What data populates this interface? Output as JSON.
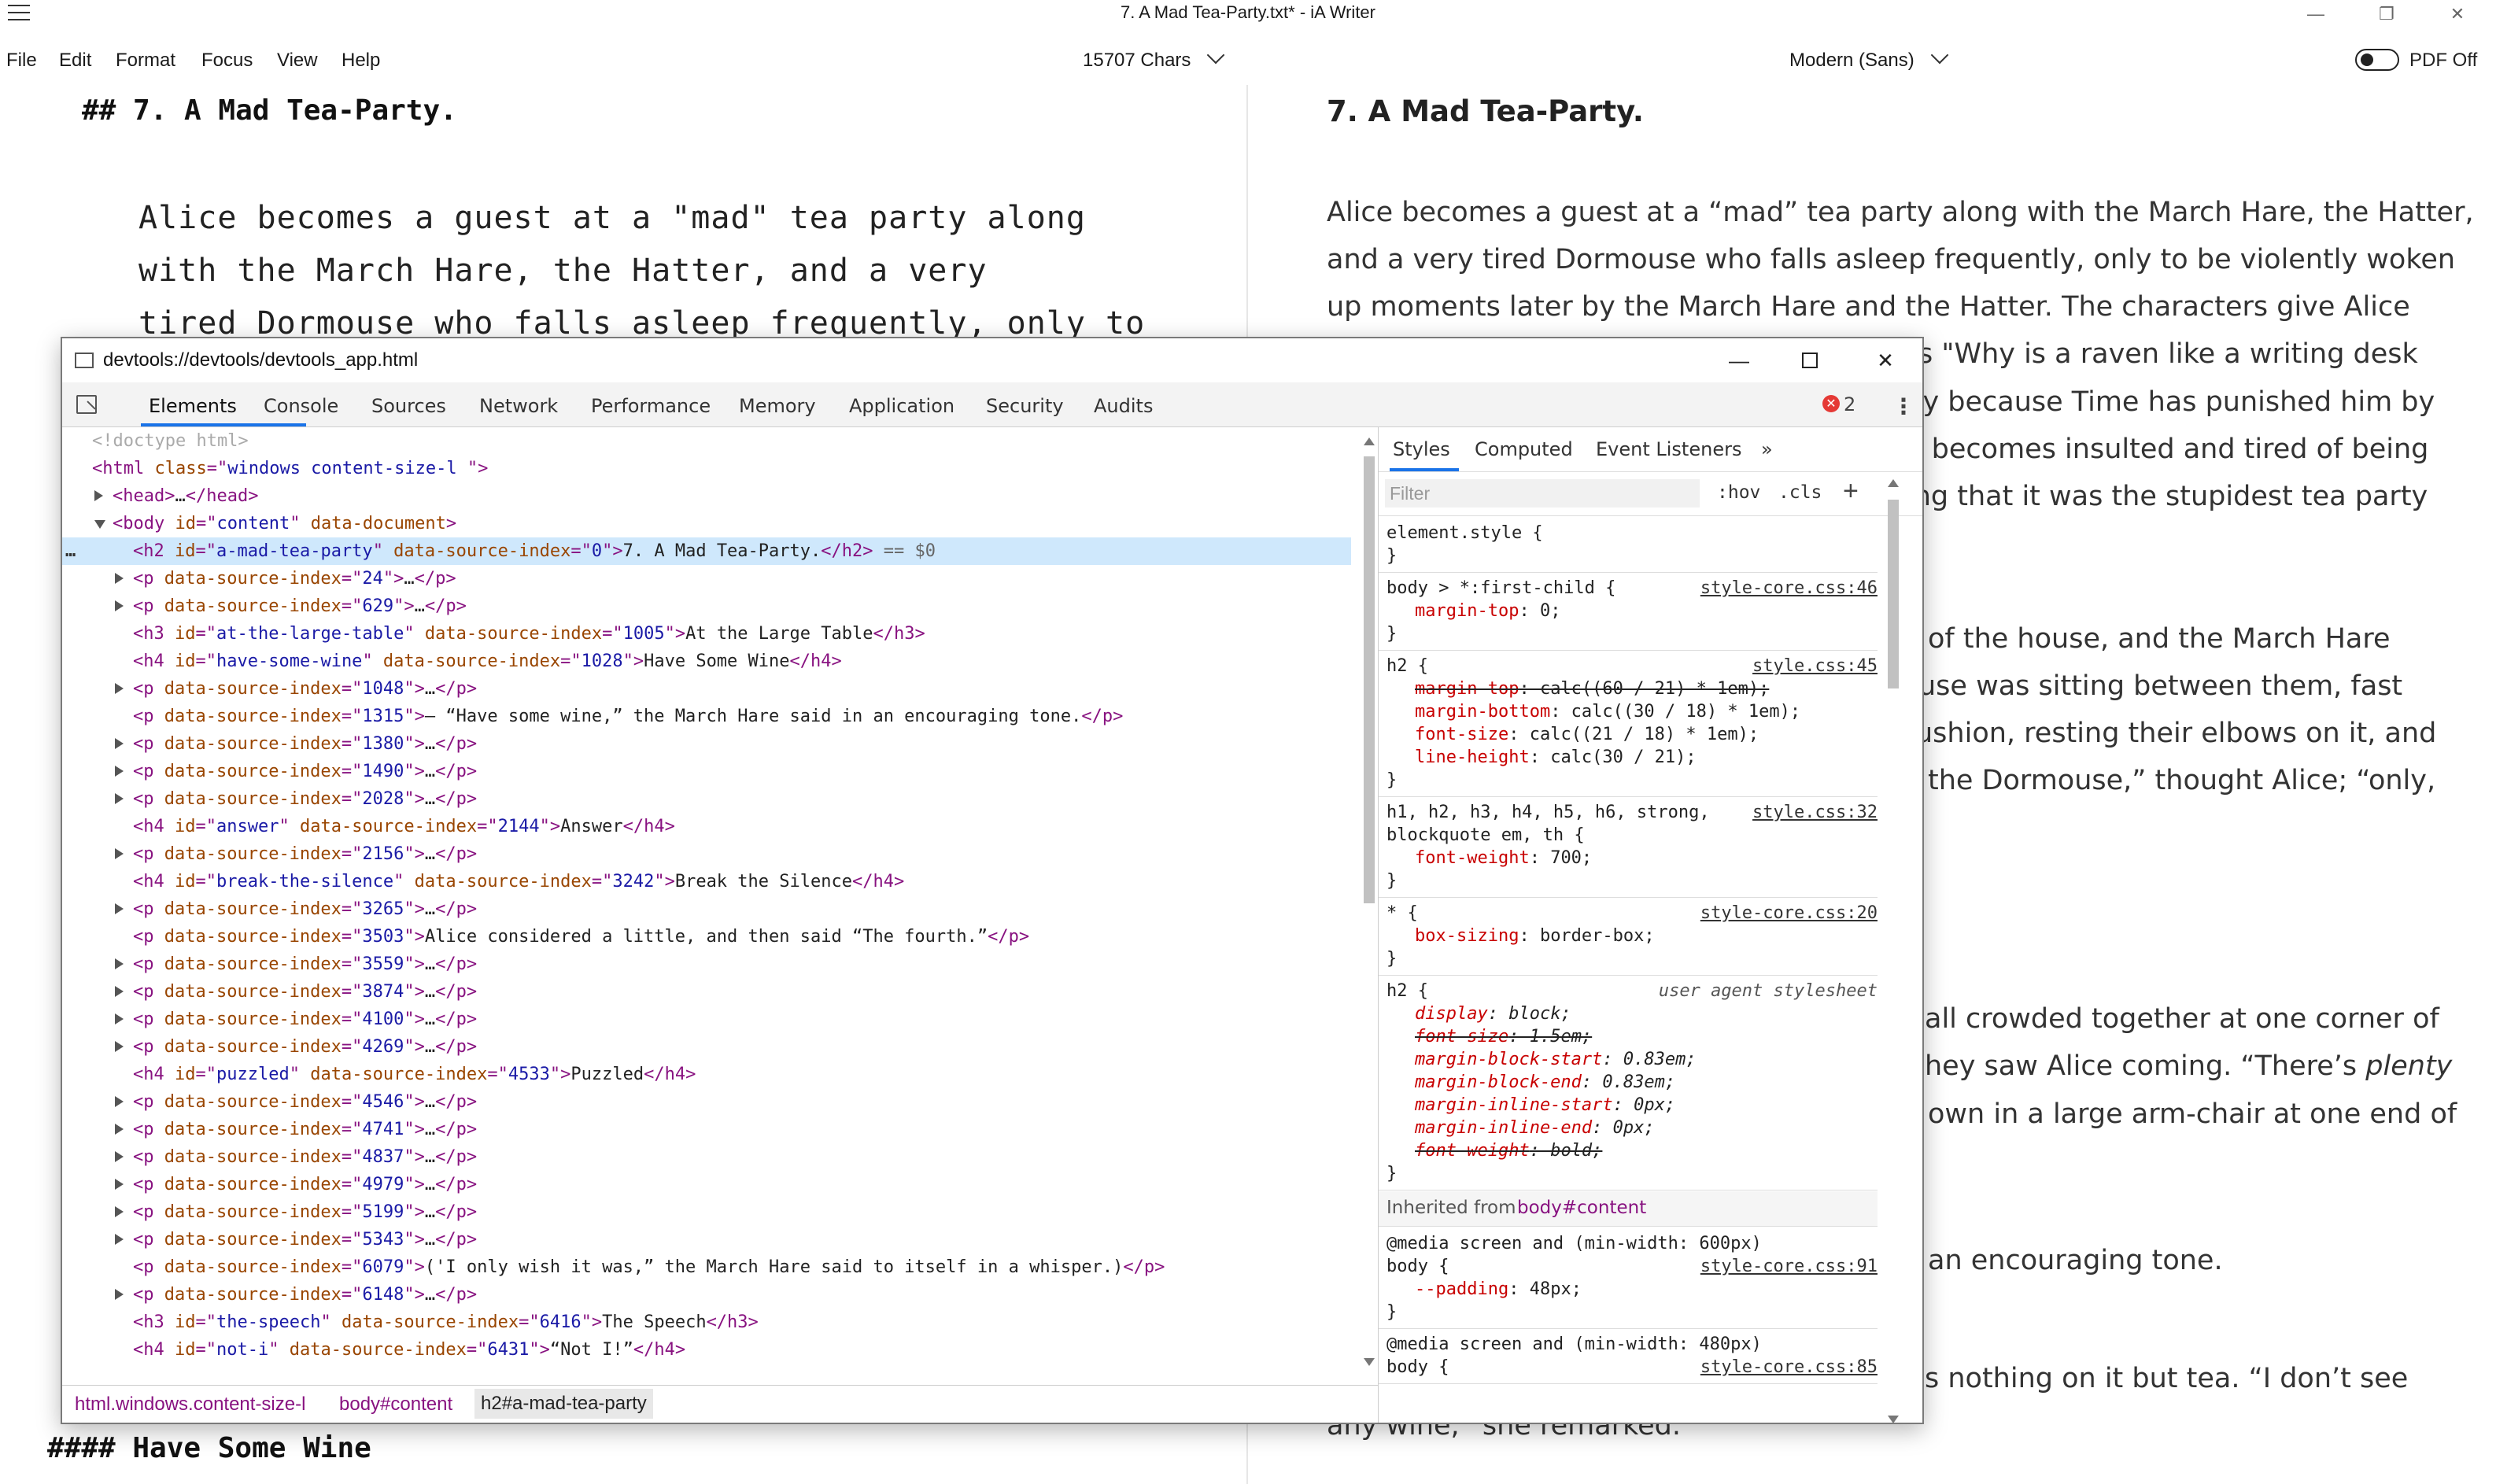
{
  "window": {
    "title": "7. A Mad Tea-Party.txt*  - iA Writer",
    "controls": [
      "—",
      "❐",
      "✕"
    ]
  },
  "menu": [
    "File",
    "Edit",
    "Format",
    "Focus",
    "View",
    "Help"
  ],
  "stats": {
    "chars": "15707 Chars",
    "font": "Modern (Sans)",
    "pdf": "PDF Off"
  },
  "editor": {
    "heading": "## 7. A Mad Tea-Party.",
    "paragraph_lines": [
      "Alice becomes a guest at a \"mad\" tea party along",
      "with the March Hare, the Hatter, and a very",
      "tired Dormouse who falls asleep frequently, only to"
    ],
    "bottom_heading": "#### Have Some Wine"
  },
  "preview": {
    "heading": "7. A Mad Tea-Party.",
    "lines_full": [
      "Alice becomes a guest at a “mad” tea party along with the March Hare, the Hatter,",
      "and a very tired Dormouse who falls asleep frequently, only to be violently woken",
      "up moments later by the March Hare and the Hatter. The characters give Alice"
    ],
    "lines_partial": [
      "s \"Why is a raven like a writing desk",
      "ay because Time has punished him by",
      "e becomes insulted and tired of being",
      "ing that it was the stupidest tea party",
      "of the house, and the March Hare",
      "use was sitting between them, fast",
      "ushion, resting their elbows on it, and",
      "the Dormouse,” thought Alice; “only,",
      "all crowded together at one corner of",
      "hey saw Alice coming. “There’s ",
      "own in a large arm-chair at one end of",
      "an encouraging tone.",
      "s nothing on it but tea. “I don’t see"
    ],
    "italic_word": "plenty",
    "bottom_line": "any wine,” she remarked."
  },
  "devtools": {
    "title": "devtools://devtools/devtools_app.html",
    "tabs": [
      "Elements",
      "Console",
      "Sources",
      "Network",
      "Performance",
      "Memory",
      "Application",
      "Security",
      "Audits"
    ],
    "error_count": "2",
    "error_icon": "✕",
    "more_icon": "⋮",
    "dom": [
      {
        "indent": 0,
        "kind": "comment",
        "text": "<!doctype html>"
      },
      {
        "indent": 0,
        "kind": "open",
        "tag": "html",
        "attrs": [
          [
            "class",
            "windows content-size-l "
          ]
        ],
        "suffix": ">"
      },
      {
        "indent": 1,
        "kind": "collapsed",
        "tag": "head",
        "attrs": [],
        "arrow": "r"
      },
      {
        "indent": 1,
        "kind": "open",
        "tag": "body",
        "attrs": [
          [
            "id",
            "content"
          ],
          [
            "data-document",
            null
          ]
        ],
        "arrow": "d"
      },
      {
        "indent": 2,
        "kind": "full",
        "tag": "h2",
        "attrs": [
          [
            "id",
            "a-mad-tea-party"
          ],
          [
            "data-source-index",
            "0"
          ]
        ],
        "text": "7. A Mad Tea-Party.",
        "selected": true,
        "eq": " == $0"
      },
      {
        "indent": 2,
        "kind": "collapsed",
        "tag": "p",
        "attrs": [
          [
            "data-source-index",
            "24"
          ]
        ],
        "arrow": "r"
      },
      {
        "indent": 2,
        "kind": "collapsed",
        "tag": "p",
        "attrs": [
          [
            "data-source-index",
            "629"
          ]
        ],
        "arrow": "r"
      },
      {
        "indent": 2,
        "kind": "full",
        "tag": "h3",
        "attrs": [
          [
            "id",
            "at-the-large-table"
          ],
          [
            "data-source-index",
            "1005"
          ]
        ],
        "text": "At the Large Table"
      },
      {
        "indent": 2,
        "kind": "full",
        "tag": "h4",
        "attrs": [
          [
            "id",
            "have-some-wine"
          ],
          [
            "data-source-index",
            "1028"
          ]
        ],
        "text": "Have Some Wine"
      },
      {
        "indent": 2,
        "kind": "collapsed",
        "tag": "p",
        "attrs": [
          [
            "data-source-index",
            "1048"
          ]
        ],
        "arrow": "r"
      },
      {
        "indent": 2,
        "kind": "full",
        "tag": "p",
        "attrs": [
          [
            "data-source-index",
            "1315"
          ]
        ],
        "text": "— “Have some wine,” the March Hare said in an encouraging tone."
      },
      {
        "indent": 2,
        "kind": "collapsed",
        "tag": "p",
        "attrs": [
          [
            "data-source-index",
            "1380"
          ]
        ],
        "arrow": "r"
      },
      {
        "indent": 2,
        "kind": "collapsed",
        "tag": "p",
        "attrs": [
          [
            "data-source-index",
            "1490"
          ]
        ],
        "arrow": "r"
      },
      {
        "indent": 2,
        "kind": "collapsed",
        "tag": "p",
        "attrs": [
          [
            "data-source-index",
            "2028"
          ]
        ],
        "arrow": "r"
      },
      {
        "indent": 2,
        "kind": "full",
        "tag": "h4",
        "attrs": [
          [
            "id",
            "answer"
          ],
          [
            "data-source-index",
            "2144"
          ]
        ],
        "text": "Answer"
      },
      {
        "indent": 2,
        "kind": "collapsed",
        "tag": "p",
        "attrs": [
          [
            "data-source-index",
            "2156"
          ]
        ],
        "arrow": "r"
      },
      {
        "indent": 2,
        "kind": "full",
        "tag": "h4",
        "attrs": [
          [
            "id",
            "break-the-silence"
          ],
          [
            "data-source-index",
            "3242"
          ]
        ],
        "text": "Break the Silence"
      },
      {
        "indent": 2,
        "kind": "collapsed",
        "tag": "p",
        "attrs": [
          [
            "data-source-index",
            "3265"
          ]
        ],
        "arrow": "r"
      },
      {
        "indent": 2,
        "kind": "full",
        "tag": "p",
        "attrs": [
          [
            "data-source-index",
            "3503"
          ]
        ],
        "text": "Alice considered a little, and then said “The fourth.”"
      },
      {
        "indent": 2,
        "kind": "collapsed",
        "tag": "p",
        "attrs": [
          [
            "data-source-index",
            "3559"
          ]
        ],
        "arrow": "r"
      },
      {
        "indent": 2,
        "kind": "collapsed",
        "tag": "p",
        "attrs": [
          [
            "data-source-index",
            "3874"
          ]
        ],
        "arrow": "r"
      },
      {
        "indent": 2,
        "kind": "collapsed",
        "tag": "p",
        "attrs": [
          [
            "data-source-index",
            "4100"
          ]
        ],
        "arrow": "r"
      },
      {
        "indent": 2,
        "kind": "collapsed",
        "tag": "p",
        "attrs": [
          [
            "data-source-index",
            "4269"
          ]
        ],
        "arrow": "r"
      },
      {
        "indent": 2,
        "kind": "full",
        "tag": "h4",
        "attrs": [
          [
            "id",
            "puzzled"
          ],
          [
            "data-source-index",
            "4533"
          ]
        ],
        "text": "Puzzled"
      },
      {
        "indent": 2,
        "kind": "collapsed",
        "tag": "p",
        "attrs": [
          [
            "data-source-index",
            "4546"
          ]
        ],
        "arrow": "r"
      },
      {
        "indent": 2,
        "kind": "collapsed",
        "tag": "p",
        "attrs": [
          [
            "data-source-index",
            "4741"
          ]
        ],
        "arrow": "r"
      },
      {
        "indent": 2,
        "kind": "collapsed",
        "tag": "p",
        "attrs": [
          [
            "data-source-index",
            "4837"
          ]
        ],
        "arrow": "r"
      },
      {
        "indent": 2,
        "kind": "collapsed",
        "tag": "p",
        "attrs": [
          [
            "data-source-index",
            "4979"
          ]
        ],
        "arrow": "r"
      },
      {
        "indent": 2,
        "kind": "collapsed",
        "tag": "p",
        "attrs": [
          [
            "data-source-index",
            "5199"
          ]
        ],
        "arrow": "r"
      },
      {
        "indent": 2,
        "kind": "collapsed",
        "tag": "p",
        "attrs": [
          [
            "data-source-index",
            "5343"
          ]
        ],
        "arrow": "r"
      },
      {
        "indent": 2,
        "kind": "full",
        "tag": "p",
        "attrs": [
          [
            "data-source-index",
            "6079"
          ]
        ],
        "text": "('I only wish it was,” the March Hare said to itself in a whisper.)"
      },
      {
        "indent": 2,
        "kind": "collapsed",
        "tag": "p",
        "attrs": [
          [
            "data-source-index",
            "6148"
          ]
        ],
        "arrow": "r"
      },
      {
        "indent": 2,
        "kind": "full",
        "tag": "h3",
        "attrs": [
          [
            "id",
            "the-speech"
          ],
          [
            "data-source-index",
            "6416"
          ]
        ],
        "text": "The Speech"
      },
      {
        "indent": 2,
        "kind": "full",
        "tag": "h4",
        "attrs": [
          [
            "id",
            "not-i"
          ],
          [
            "data-source-index",
            "6431"
          ]
        ],
        "text": "“Not I!”"
      }
    ],
    "breadcrumb": [
      "html.windows.content-size-l",
      "body#content",
      "h2#a-mad-tea-party"
    ],
    "styles": {
      "tabs": [
        "Styles",
        "Computed",
        "Event Listeners"
      ],
      "more_tabs": "»",
      "filter_placeholder": "Filter",
      "hov": ":hov",
      "cls": ".cls",
      "add": "+",
      "rules": [
        {
          "lines": [
            {
              "t": "sel",
              "text": "element.style {"
            },
            {
              "t": "close",
              "text": "}"
            }
          ]
        },
        {
          "source": "style-core.css:46",
          "lines": [
            {
              "t": "sel",
              "text": "body > *:first-child {"
            },
            {
              "t": "prop",
              "p": "margin-top",
              "v": "0;"
            },
            {
              "t": "close",
              "text": "}"
            }
          ]
        },
        {
          "source": "style.css:45",
          "lines": [
            {
              "t": "sel",
              "text": "h2 {"
            },
            {
              "t": "prop",
              "p": "margin-top",
              "v": "calc((60 / 21) * 1em);",
              "strike": true
            },
            {
              "t": "prop",
              "p": "margin-bottom",
              "v": "calc((30 / 18) * 1em);"
            },
            {
              "t": "prop",
              "p": "font-size",
              "v": "calc((21 / 18) * 1em);"
            },
            {
              "t": "prop",
              "p": "line-height",
              "v": "calc(30 / 21);"
            },
            {
              "t": "close",
              "text": "}"
            }
          ]
        },
        {
          "source": "style.css:32",
          "lines": [
            {
              "t": "sel",
              "text": "h1, h2, h3, h4, h5, h6, strong,"
            },
            {
              "t": "sel2",
              "text": "blockquote em, th {"
            },
            {
              "t": "prop",
              "p": "font-weight",
              "v": "700;"
            },
            {
              "t": "close",
              "text": "}"
            }
          ]
        },
        {
          "source": "style-core.css:20",
          "lines": [
            {
              "t": "sel",
              "text": "* {"
            },
            {
              "t": "prop",
              "p": "box-sizing",
              "v": "border-box;"
            },
            {
              "t": "close",
              "text": "}"
            }
          ]
        },
        {
          "source": "user agent stylesheet",
          "ua": true,
          "lines": [
            {
              "t": "sel",
              "text": "h2 {"
            },
            {
              "t": "prop",
              "p": "display",
              "v": "block;"
            },
            {
              "t": "prop",
              "p": "font-size",
              "v": "1.5em;",
              "strike": true
            },
            {
              "t": "prop",
              "p": "margin-block-start",
              "v": "0.83em;"
            },
            {
              "t": "prop",
              "p": "margin-block-end",
              "v": "0.83em;"
            },
            {
              "t": "prop",
              "p": "margin-inline-start",
              "v": "0px;"
            },
            {
              "t": "prop",
              "p": "margin-inline-end",
              "v": "0px;"
            },
            {
              "t": "prop",
              "p": "font-weight",
              "v": "bold;",
              "strike": true
            },
            {
              "t": "close",
              "text": "}"
            }
          ]
        }
      ],
      "inherited_label": "Inherited from ",
      "inherited_from": "body#content",
      "media_rules": [
        {
          "media": "@media screen and (min-width: 600px)",
          "source": "style-core.css:91",
          "selector": "body {",
          "prop": "--padding",
          "value": "48px;"
        },
        {
          "media": "@media screen and (min-width: 480px)",
          "source": "style-core.css:85",
          "selector": "body {"
        }
      ]
    }
  },
  "colors": {
    "accent": "#1a73e8",
    "selection": "#cfe8fc",
    "tag": "#881280",
    "attr": "#994500",
    "value": "#1a1aa6",
    "prop": "#c80000",
    "error": "#e53935"
  }
}
